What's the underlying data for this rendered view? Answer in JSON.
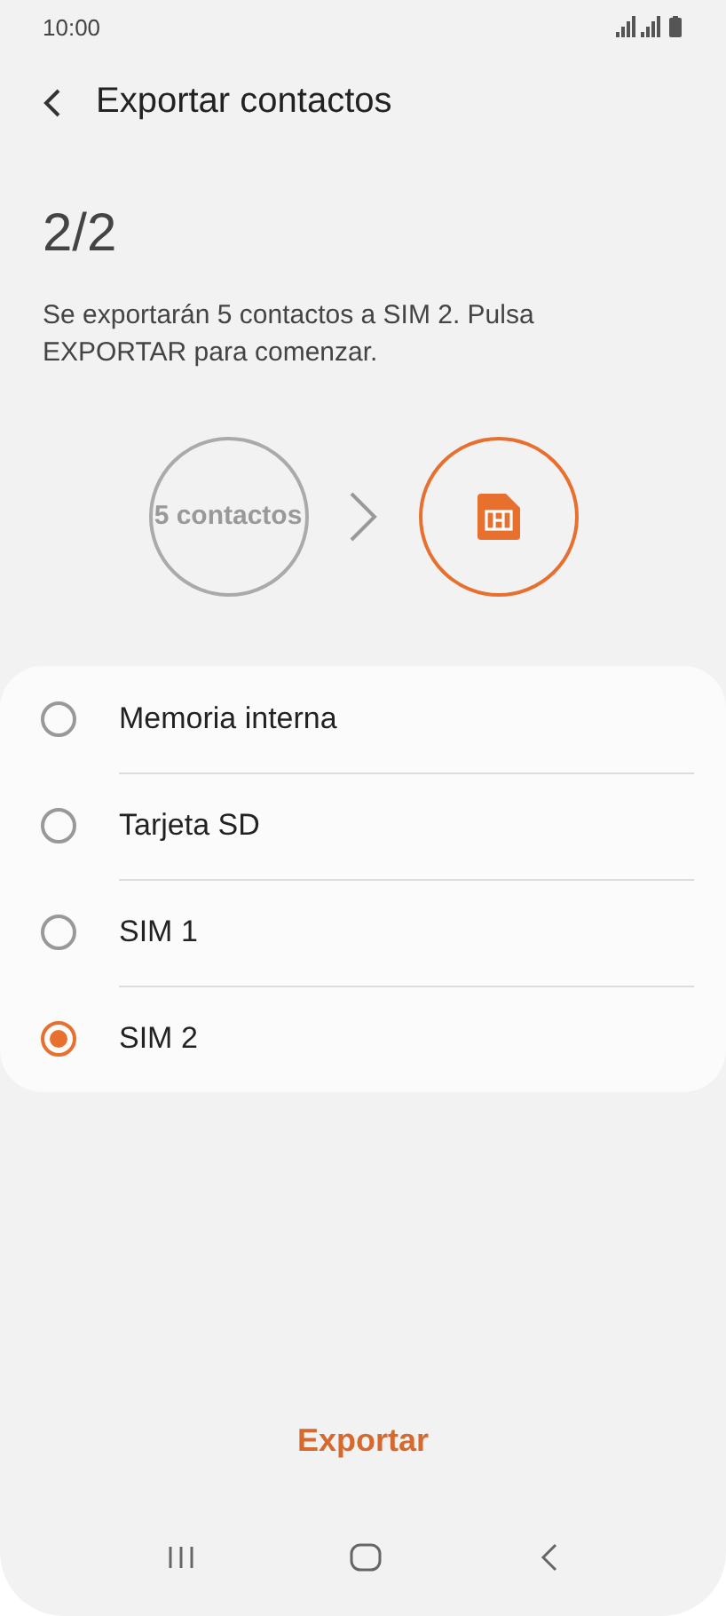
{
  "status_bar": {
    "time": "10:00"
  },
  "header": {
    "title": "Exportar contactos"
  },
  "step": "2/2",
  "description": "Se exportarán 5 contactos a SIM 2. Pulsa EXPORTAR para comenzar.",
  "transfer": {
    "source": "5 contactos"
  },
  "options": [
    {
      "label": "Memoria interna",
      "selected": false
    },
    {
      "label": "Tarjeta SD",
      "selected": false
    },
    {
      "label": "SIM 1",
      "selected": false
    },
    {
      "label": "SIM 2",
      "selected": true
    }
  ],
  "action": {
    "label": "Exportar"
  }
}
